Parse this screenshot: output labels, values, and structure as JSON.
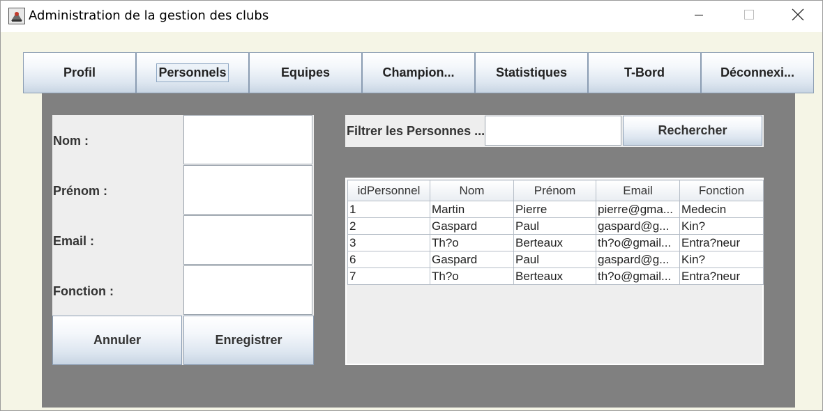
{
  "window": {
    "title": "Administration de la gestion des clubs",
    "controls": [
      "minimize-icon",
      "maximize-icon",
      "close-icon"
    ]
  },
  "tabs": [
    {
      "label": "Profil"
    },
    {
      "label": "Personnels",
      "active": true
    },
    {
      "label": "Equipes"
    },
    {
      "label": "Champion..."
    },
    {
      "label": "Statistiques"
    },
    {
      "label": "T-Bord"
    },
    {
      "label": "Déconnexi..."
    }
  ],
  "form": {
    "nom_label": "Nom :",
    "prenom_label": "Prénom :",
    "email_label": "Email :",
    "fonction_label": "Fonction :",
    "nom_value": "",
    "prenom_value": "",
    "email_value": "",
    "fonction_value": "",
    "cancel_label": "Annuler",
    "save_label": "Enregistrer"
  },
  "filter": {
    "label": "Filtrer les Personnes ...",
    "value": "",
    "search_label": "Rechercher"
  },
  "table": {
    "columns": [
      "idPersonnel",
      "Nom",
      "Prénom",
      "Email",
      "Fonction"
    ],
    "rows": [
      [
        "1",
        "Martin",
        "Pierre",
        "pierre@gma...",
        "Medecin"
      ],
      [
        "2",
        "Gaspard",
        "Paul",
        "gaspard@g...",
        "Kin?"
      ],
      [
        "3",
        "Th?o",
        "Berteaux",
        "th?o@gmail...",
        "Entra?neur"
      ],
      [
        "6",
        "Gaspard",
        "Paul",
        "gaspard@g...",
        "Kin?"
      ],
      [
        "7",
        "Th?o",
        "Berteaux",
        "th?o@gmail...",
        "Entra?neur"
      ]
    ]
  },
  "colors": {
    "content_bg": "#808080",
    "window_bg": "#f5f5e6",
    "form_bg": "#eeeeee"
  }
}
